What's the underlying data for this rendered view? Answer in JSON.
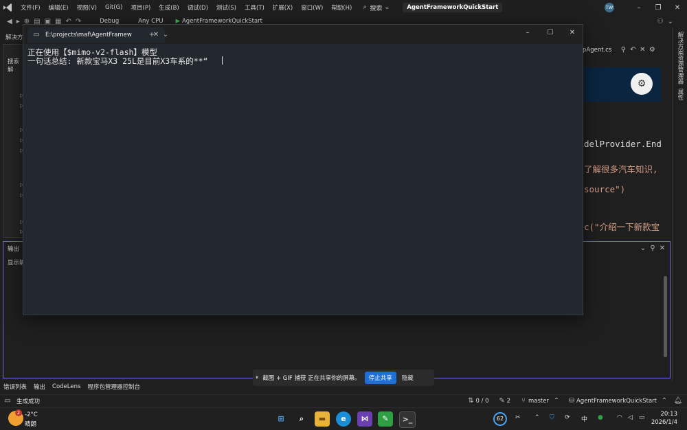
{
  "ide": {
    "menu": [
      "文件(F)",
      "编辑(E)",
      "视图(V)",
      "Git(G)",
      "项目(P)",
      "生成(B)",
      "调试(D)",
      "测试(S)",
      "工具(T)",
      "扩展(X)",
      "窗口(W)",
      "帮助(H)"
    ],
    "search_label": "搜索",
    "project_title": "AgentFrameworkQuickStart",
    "avatar_initials": "TW",
    "toolbar": {
      "config": "Debug",
      "platform": "Any CPU",
      "run_target": "AgentFrameworkQuickStart"
    },
    "solution_tab_label": "解决方",
    "search_solution_label": "搜索解",
    "editor": {
      "tab_name": "pAgent.cs",
      "code_lines": [
        {
          "text": "delProvider.End",
          "color": "#dcdcdc"
        },
        {
          "text": "了解很多汽车知识,",
          "color": "#d69d85"
        },
        {
          "text": "source\")",
          "color": "#d69d85"
        },
        {
          "text": "c(\"介绍一下新款宝",
          "color": "#d69d85"
        }
      ]
    },
    "right_rail": [
      "解决方案资源管理器",
      "属性"
    ],
    "output": {
      "title": "输出",
      "show_label": "显示输"
    },
    "bottom_tabs": [
      "错误列表",
      "输出",
      "CodeLens",
      "程序包管理器控制台"
    ],
    "status": {
      "build": "生成成功",
      "changes": "0 / 0",
      "edits": "2",
      "branch": "master",
      "repo": "AgentFrameworkQuickStart"
    }
  },
  "share": {
    "message": "截图 + GIF 捕获 正在共享你的屏幕。",
    "stop_label": "停止共享",
    "hide_label": "隐藏"
  },
  "terminal": {
    "tab_title": "E:\\projects\\maf\\AgentFramew",
    "lines": [
      "正在使用【$mimo-v2-flash】模型",
      "一句话总结: 新款宝马X3 25L是目前X3车系的**“"
    ]
  },
  "taskbar": {
    "weather_temp": "-2°C",
    "weather_desc": "晴朗",
    "weather_badge": "2",
    "notif_count": "62",
    "ime": "中",
    "time": "20:13",
    "date": "2026/1/4"
  }
}
